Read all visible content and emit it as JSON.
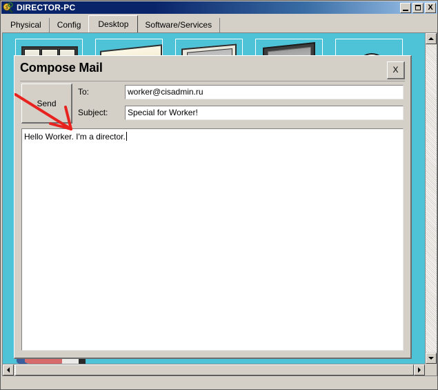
{
  "window": {
    "title": "DIRECTOR-PC",
    "icon": "packet-tracer-icon",
    "minimize_label": "_",
    "maximize_label": "□",
    "close_label": "X"
  },
  "tabs": [
    {
      "label": "Physical",
      "active": false
    },
    {
      "label": "Config",
      "active": false
    },
    {
      "label": "Desktop",
      "active": true
    },
    {
      "label": "Software/Services",
      "active": false
    }
  ],
  "desktop": {
    "background_color": "#4ec3d8",
    "icons": [
      {
        "name": "icon-tile-1",
        "art": "monitors"
      },
      {
        "name": "icon-tile-2",
        "art": "folder"
      },
      {
        "name": "icon-tile-3",
        "art": "display"
      },
      {
        "name": "icon-tile-4",
        "art": "dark-monitor"
      },
      {
        "name": "icon-tile-5",
        "art": "cloud"
      }
    ]
  },
  "compose": {
    "title": "Compose Mail",
    "close_label": "X",
    "send_label": "Send",
    "to": {
      "label": "To:",
      "value": "worker@cisadmin.ru"
    },
    "subject": {
      "label": "Subject:",
      "value": "Special for Worker!"
    },
    "body": {
      "value": "Hello Worker. I'm a director."
    }
  },
  "annotation": {
    "type": "red-arrow",
    "color": "#e8231f",
    "points_to": "send-button"
  },
  "scrollbars": {
    "vertical": {
      "up": "▲",
      "down": "▼"
    },
    "horizontal": {
      "left": "◄",
      "right": "►"
    }
  }
}
